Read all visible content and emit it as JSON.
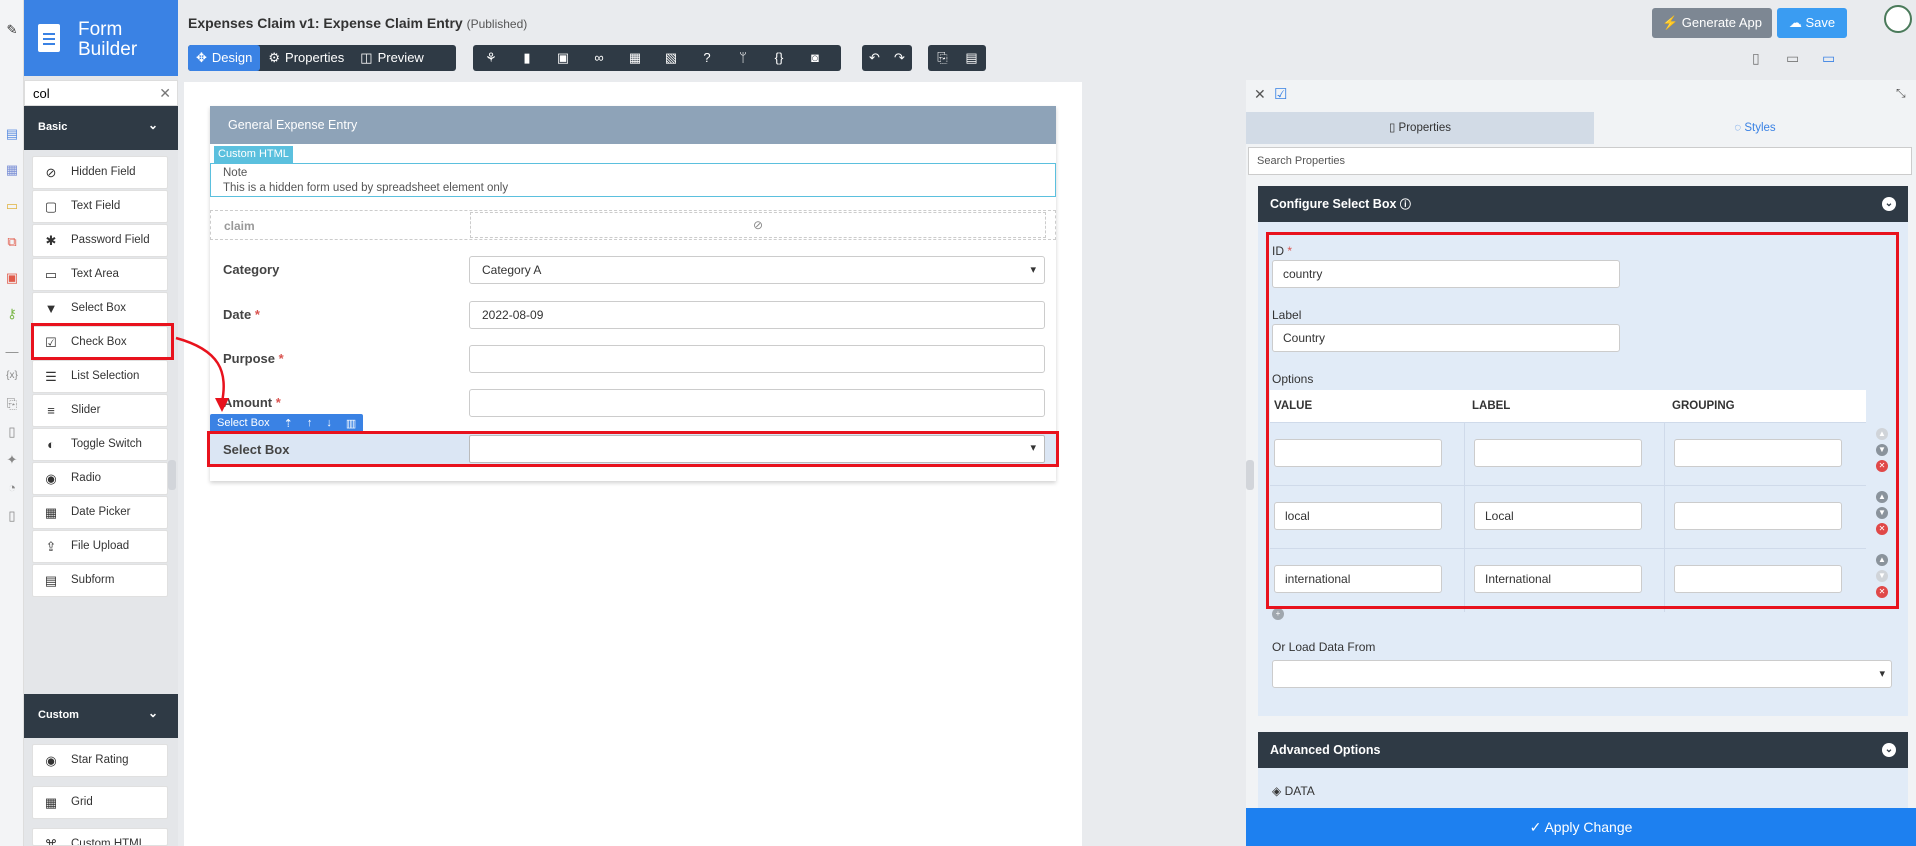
{
  "brand": {
    "line1": "Form",
    "line2": "Builder"
  },
  "palette": {
    "search_value": "col",
    "categories": [
      "Basic",
      "Custom"
    ],
    "basic_items": [
      "Hidden Field",
      "Text Field",
      "Password Field",
      "Text Area",
      "Select Box",
      "Check Box",
      "List Selection",
      "Slider",
      "Toggle Switch",
      "Radio",
      "Date Picker",
      "File Upload",
      "Subform"
    ],
    "custom_items": [
      "Star Rating",
      "Grid",
      "Custom HTML"
    ]
  },
  "header": {
    "title": "Expenses Claim v1: Expense Claim Entry",
    "status": "(Published)",
    "tabs": [
      "Design",
      "Properties",
      "Preview"
    ],
    "generate_app": "Generate App",
    "save": "Save"
  },
  "form": {
    "section_title": "General Expense Entry",
    "custom_html_tag": "Custom HTML",
    "note_title": "Note",
    "note_text": "This is a hidden form used by spreadsheet element only",
    "hidden_label": "claim",
    "fields": [
      {
        "label": "Category",
        "value": "Category A",
        "required": false
      },
      {
        "label": "Date",
        "value": "2022-08-09",
        "required": true
      },
      {
        "label": "Purpose",
        "value": "",
        "required": true
      },
      {
        "label": "Amount",
        "value": "",
        "required": true
      }
    ],
    "selected_tag": "Select Box",
    "selected_label": "Select Box"
  },
  "panel": {
    "tabs": [
      "Properties",
      "Styles"
    ],
    "search_placeholder": "Search Properties",
    "config_title": "Configure Select Box",
    "id_label": "ID",
    "id_value": "country",
    "label_label": "Label",
    "label_value": "Country",
    "options_label": "Options",
    "option_columns": [
      "VALUE",
      "LABEL",
      "GROUPING"
    ],
    "options": [
      {
        "value": "",
        "label": "",
        "grouping": ""
      },
      {
        "value": "local",
        "label": "Local",
        "grouping": ""
      },
      {
        "value": "international",
        "label": "International",
        "grouping": ""
      }
    ],
    "load_label": "Or Load Data From",
    "advanced_title": "Advanced Options",
    "data_label": "DATA",
    "apply": "Apply Change"
  },
  "colors": {
    "accent": "#3a82e4",
    "dark": "#2f3a45",
    "highlight": "#e8121d",
    "apply": "#1d80f0"
  }
}
